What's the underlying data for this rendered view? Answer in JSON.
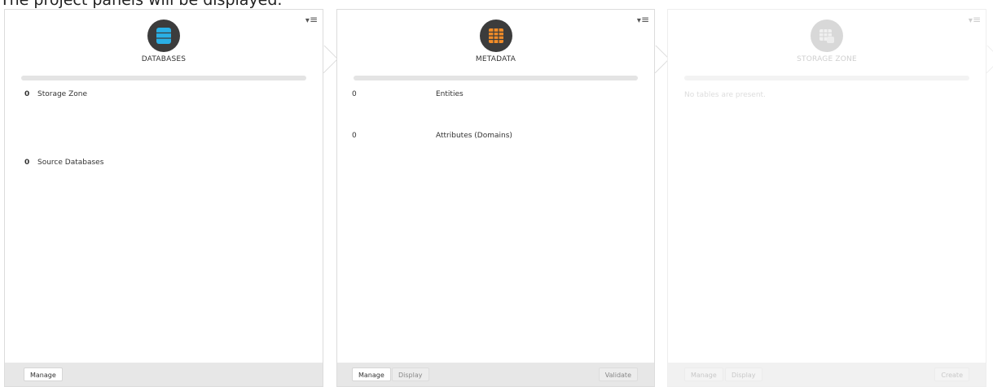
{
  "caption": "The project panels will be displayed.",
  "panels": {
    "databases": {
      "title": "DATABASES",
      "icon": "database-icon",
      "icon_color": "#2ab0e6",
      "rows": [
        {
          "count": "0",
          "label": "Storage Zone"
        },
        {
          "count": "0",
          "label": "Source Databases"
        }
      ],
      "buttons": {
        "manage": "Manage"
      }
    },
    "metadata": {
      "title": "METADATA",
      "icon": "table-grid-icon",
      "icon_color": "#f28c28",
      "rows": [
        {
          "count": "0",
          "label": "Entities"
        },
        {
          "count": "0",
          "label": "Attributes (Domains)"
        }
      ],
      "buttons": {
        "manage": "Manage",
        "display": "Display",
        "validate": "Validate"
      }
    },
    "storage_zone": {
      "title": "STORAGE ZONE",
      "icon": "storage-zone-icon",
      "icon_color": "#9a9a9a",
      "empty_text": "No tables are present.",
      "buttons": {
        "manage": "Manage",
        "display": "Display",
        "create": "Create"
      }
    }
  },
  "menu_icon": "dropdown-menu-icon",
  "colors": {
    "icon_circle": "#3c3c3c",
    "footer": "#e7e7e7",
    "progress_track": "#e4e4e4"
  }
}
